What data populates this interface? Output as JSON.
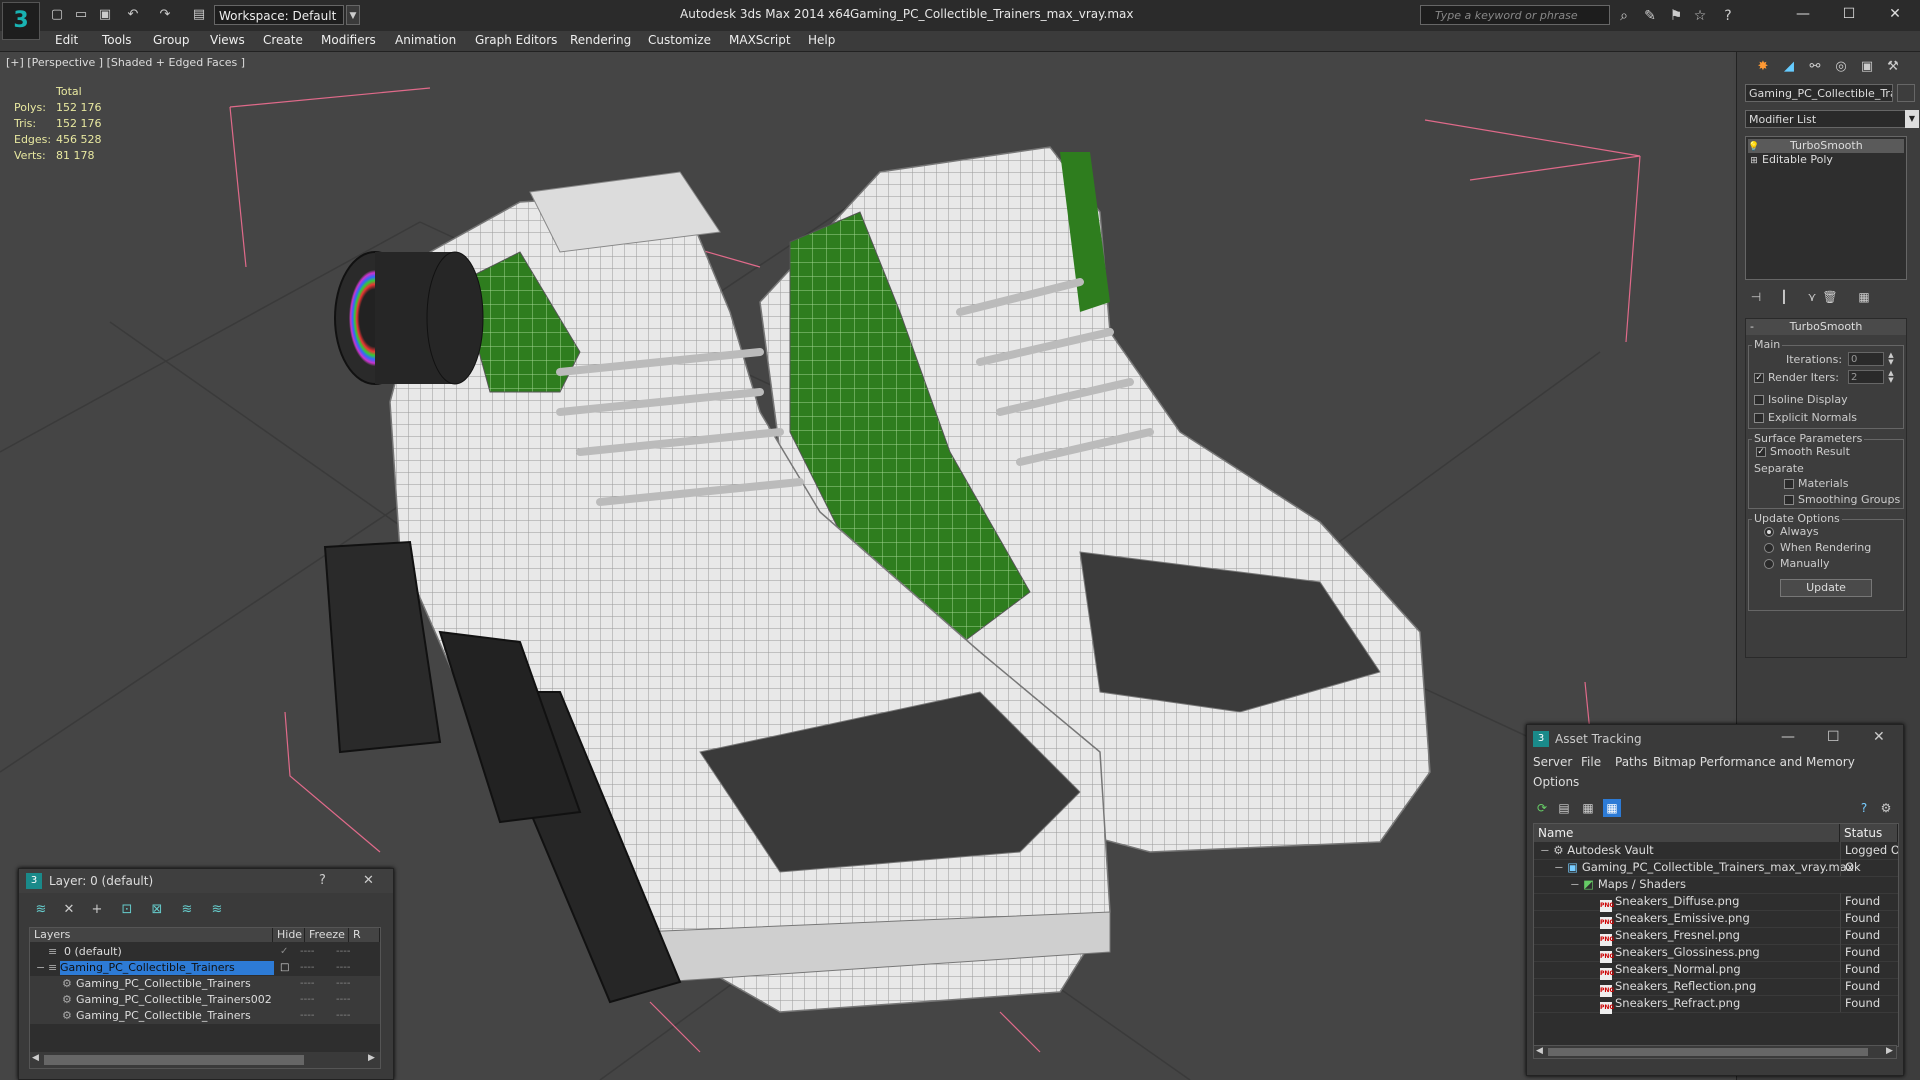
{
  "app": {
    "title": "Autodesk 3ds Max  2014 x64",
    "file": "Gaming_PC_Collectible_Trainers_max_vray.max",
    "workspace": "Workspace: Default",
    "search_placeholder": "Type a keyword or phrase"
  },
  "menu": [
    "Edit",
    "Tools",
    "Group",
    "Views",
    "Create",
    "Modifiers",
    "Animation",
    "Graph Editors",
    "Rendering",
    "Customize",
    "MAXScript",
    "Help"
  ],
  "viewport": {
    "label": "[+] [Perspective ] [Shaded + Edged Faces ]",
    "stats": {
      "header": "Total",
      "rows": [
        {
          "label": "Polys:",
          "value": "152 176"
        },
        {
          "label": "Tris:",
          "value": "152 176"
        },
        {
          "label": "Edges:",
          "value": "456 528"
        },
        {
          "label": "Verts:",
          "value": "81 178"
        }
      ]
    }
  },
  "command_panel": {
    "object_name": "Gaming_PC_Collectible_Trainers",
    "modifier_list": "Modifier List",
    "stack": [
      "TurboSmooth",
      "Editable Poly"
    ],
    "turbosmooth": {
      "title": "TurboSmooth",
      "main_label": "Main",
      "iterations_label": "Iterations:",
      "iterations": "0",
      "render_iters_label": "Render Iters:",
      "render_iters": "2",
      "isoline": "Isoline Display",
      "explicit_normals": "Explicit Normals",
      "surface_label": "Surface Parameters",
      "smooth_result": "Smooth Result",
      "separate": "Separate",
      "materials": "Materials",
      "smoothing_groups": "Smoothing Groups",
      "update_label": "Update Options",
      "always": "Always",
      "when_rendering": "When Rendering",
      "manually": "Manually",
      "update_button": "Update"
    }
  },
  "layer_dialog": {
    "title": "Layer: 0 (default)",
    "columns": [
      "Layers",
      "Hide",
      "Freeze",
      "R"
    ],
    "rows": [
      {
        "name": "0 (default)"
      },
      {
        "name": "Gaming_PC_Collectible_Trainers"
      },
      {
        "name": "Gaming_PC_Collectible_Trainers"
      },
      {
        "name": "Gaming_PC_Collectible_Trainers002"
      },
      {
        "name": "Gaming_PC_Collectible_Trainers"
      }
    ]
  },
  "asset_tracking": {
    "title": "Asset Tracking",
    "menu": [
      "Server",
      "File",
      "Paths",
      "Bitmap Performance and Memory",
      "Options"
    ],
    "columns": [
      "Name",
      "Status"
    ],
    "rows": [
      {
        "name": "Autodesk Vault",
        "status": "Logged O"
      },
      {
        "name": "Gaming_PC_Collectible_Trainers_max_vray.max",
        "status": "Ok"
      },
      {
        "name": "Maps / Shaders",
        "status": ""
      },
      {
        "name": "Sneakers_Diffuse.png",
        "status": "Found"
      },
      {
        "name": "Sneakers_Emissive.png",
        "status": "Found"
      },
      {
        "name": "Sneakers_Fresnel.png",
        "status": "Found"
      },
      {
        "name": "Sneakers_Glossiness.png",
        "status": "Found"
      },
      {
        "name": "Sneakers_Normal.png",
        "status": "Found"
      },
      {
        "name": "Sneakers_Reflection.png",
        "status": "Found"
      },
      {
        "name": "Sneakers_Refract.png",
        "status": "Found"
      }
    ]
  },
  "colors": {
    "viewport_bg": "#454545",
    "accent_green": "#2e7d1e",
    "selection_blue": "#2d7bd6",
    "stats_text": "#e8e8a0"
  }
}
